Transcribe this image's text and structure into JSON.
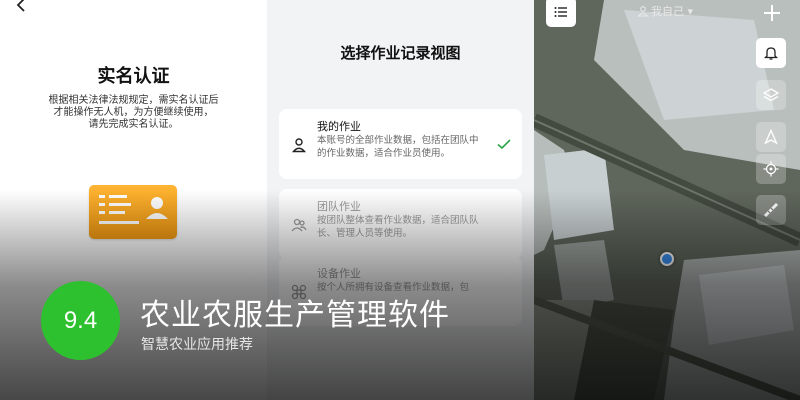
{
  "left_panel": {
    "title": "实名认证",
    "description": "根据相关法律法规规定，需实名认证后\n才能操作无人机，为方便继续使用，\n请先完成实名认证。",
    "icons": {
      "back": "chevron-left-icon",
      "card": "id-card-icon"
    }
  },
  "middle_panel": {
    "title": "选择作业记录视图",
    "options": [
      {
        "title": "我的作业",
        "desc": "本账号的全部作业数据，包括在团队中的作业数据，适合作业员使用。",
        "icon": "person-icon",
        "selected": true
      },
      {
        "title": "团队作业",
        "desc": "按团队整体查看作业数据，适合团队队长、管理人员等使用。",
        "icon": "team-icon",
        "selected": false
      },
      {
        "title": "设备作业",
        "desc": "按个人所拥有设备查看作业数据，包",
        "icon": "device-icon",
        "selected": false
      }
    ]
  },
  "right_panel": {
    "scope_label": "我自己 ▾",
    "icons": [
      "list-icon",
      "plus-icon",
      "bell-icon",
      "layers-icon",
      "navigate-icon",
      "locate-icon",
      "ruler-icon"
    ]
  },
  "overlay": {
    "score": "9.4",
    "app_name": "农业农服生产管理软件",
    "subtitle": "智慧农业应用推荐",
    "badge_color": "#2ec12f"
  }
}
